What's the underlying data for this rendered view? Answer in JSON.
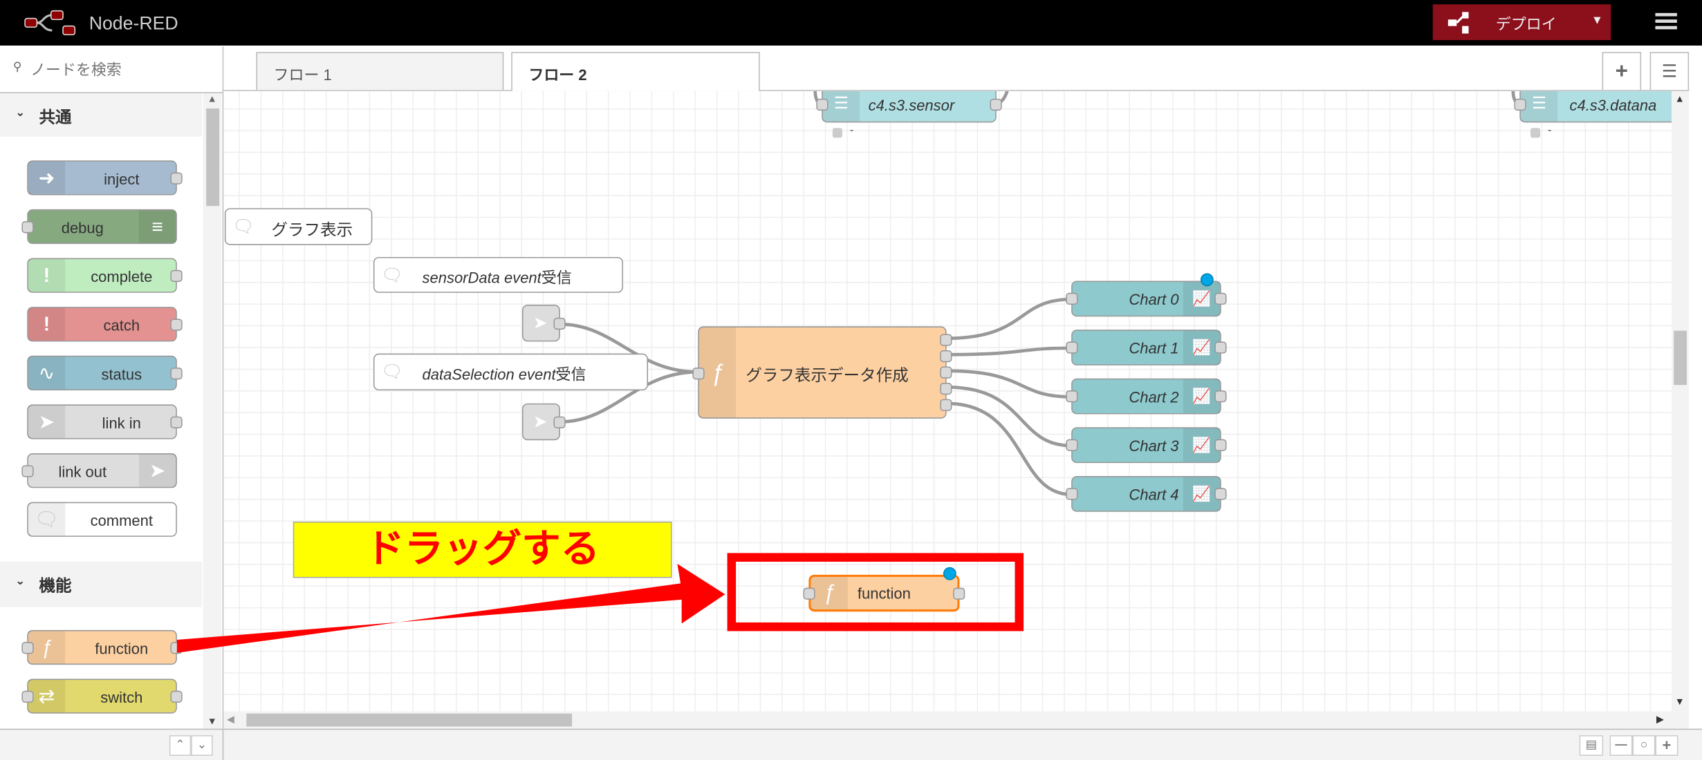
{
  "header": {
    "app_title": "Node-RED",
    "deploy_label": "デプロイ",
    "colors": {
      "header_bg": "#000000",
      "deploy_bg": "#8c101c"
    }
  },
  "sidebar": {
    "search_placeholder": "ノードを検索",
    "categories": [
      {
        "label": "共通",
        "nodes": [
          {
            "label": "inject",
            "color": "#a6bbcf",
            "icon": "arrow-right-icon"
          },
          {
            "label": "debug",
            "color": "#87a980",
            "icon": "list-icon"
          },
          {
            "label": "complete",
            "color": "#c0edc0",
            "icon": "exclamation-icon"
          },
          {
            "label": "catch",
            "color": "#e49191",
            "icon": "exclamation-icon"
          },
          {
            "label": "status",
            "color": "#94c1d0",
            "icon": "pulse-icon"
          },
          {
            "label": "link in",
            "color": "#dddddd",
            "icon": "link-icon"
          },
          {
            "label": "link out",
            "color": "#dddddd",
            "icon": "link-icon"
          },
          {
            "label": "comment",
            "color": "#ffffff",
            "icon": "speech-bubble-icon"
          }
        ]
      },
      {
        "label": "機能",
        "nodes": [
          {
            "label": "function",
            "color": "#fdd0a2",
            "icon": "function-icon"
          },
          {
            "label": "switch",
            "color": "#e2d96e",
            "icon": "switch-icon"
          }
        ]
      }
    ]
  },
  "tabs": [
    {
      "label": "フロー 1",
      "active": false
    },
    {
      "label": "フロー 2",
      "active": true
    }
  ],
  "canvas": {
    "nodes": {
      "sensor": "c4.s3.sensor",
      "datana": "c4.s3.datana",
      "status_dash": "-",
      "comment_graph": "グラフ表示",
      "comment_sensor_italic": "sensorData event",
      "comment_sensor_rest": "受信",
      "comment_selection_italic": "dataSelection event",
      "comment_selection_rest": "受信",
      "function_main": "グラフ表示データ作成",
      "charts": [
        "Chart 0",
        "Chart 1",
        "Chart 2",
        "Chart 3",
        "Chart 4"
      ],
      "dragged_function": "function"
    },
    "annotation": {
      "callout_text": "ドラッグする",
      "callout_bg": "#ffff00",
      "callout_color": "#ff0000",
      "arrow_color": "#ff0000"
    }
  }
}
